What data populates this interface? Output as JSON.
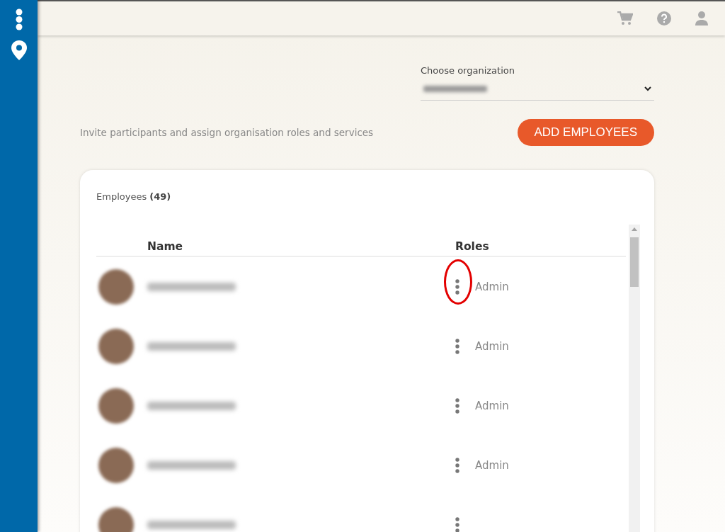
{
  "organization": {
    "label": "Choose organization",
    "value_redacted": true
  },
  "intro": "Invite participants and assign organisation roles and services",
  "add_button": "ADD EMPLOYEES",
  "employees": {
    "title": "Employees **(49)**",
    "columns": [
      "Name",
      "Roles"
    ],
    "rows": [
      {
        "name_redacted": true,
        "role": "Admin",
        "highlighted": true
      },
      {
        "name_redacted": true,
        "role": "Admin",
        "highlighted": false
      },
      {
        "name_redacted": true,
        "role": "Admin",
        "highlighted": false
      },
      {
        "name_redacted": true,
        "role": "Admin",
        "highlighted": false
      },
      {
        "name_redacted": true,
        "highlighted": false
      }
    ]
  }
}
